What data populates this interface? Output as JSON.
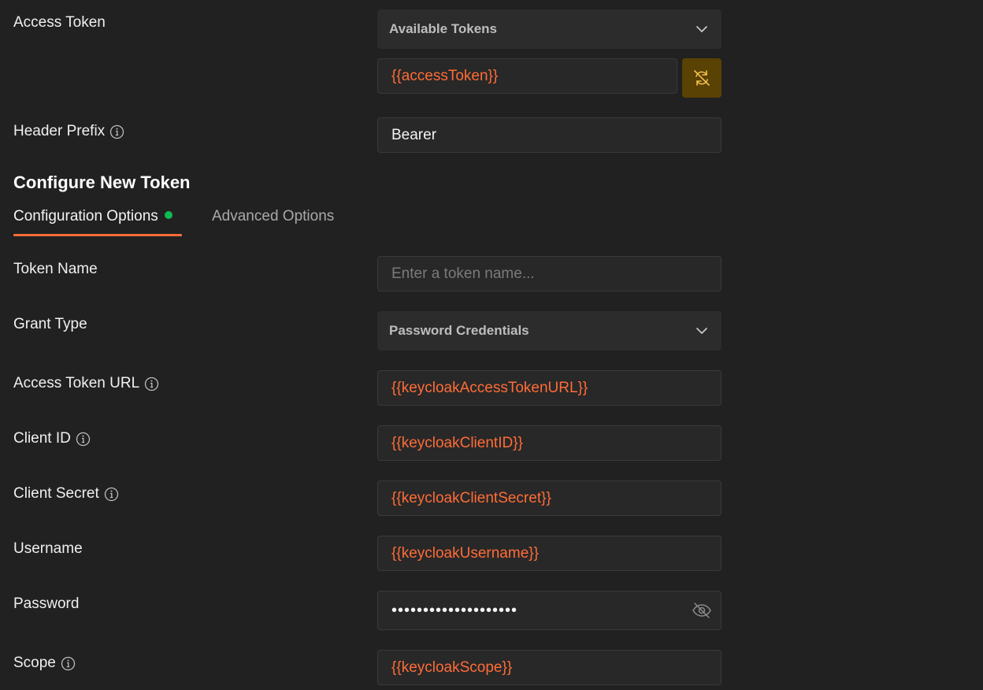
{
  "access_token": {
    "label": "Access Token",
    "available_tokens_label": "Available Tokens",
    "value": "{{accessToken}}"
  },
  "header_prefix": {
    "label": "Header Prefix",
    "value": "Bearer"
  },
  "configure": {
    "title": "Configure New Token",
    "tabs": [
      {
        "label": "Configuration Options",
        "active": true
      },
      {
        "label": "Advanced Options",
        "active": false
      }
    ]
  },
  "fields": {
    "token_name": {
      "label": "Token Name",
      "placeholder": "Enter a token name..."
    },
    "grant_type": {
      "label": "Grant Type",
      "value": "Password Credentials"
    },
    "access_token_url": {
      "label": "Access Token URL",
      "value": "{{keycloakAccessTokenURL}}"
    },
    "client_id": {
      "label": "Client ID",
      "value": "{{keycloakClientID}}"
    },
    "client_secret": {
      "label": "Client Secret",
      "value": "{{keycloakClientSecret}}"
    },
    "username": {
      "label": "Username",
      "value": "{{keycloakUsername}}"
    },
    "password": {
      "label": "Password",
      "value": "••••••••••••••••••••"
    },
    "scope": {
      "label": "Scope",
      "value": "{{keycloakScope}}"
    }
  },
  "colors": {
    "background": "#212121",
    "accent": "#ff6c37",
    "variable_text": "#ff6c37",
    "sync_button": "#5a4104",
    "status_dot": "#0cbb52"
  },
  "icons": [
    "info-icon",
    "chevron-down-icon",
    "sync-off-icon",
    "eye-off-icon"
  ]
}
